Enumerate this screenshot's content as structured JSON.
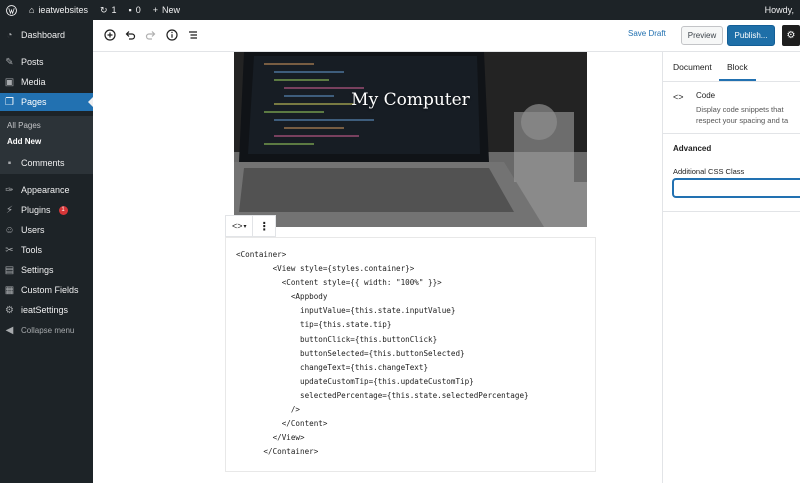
{
  "admin_bar": {
    "site_name": "ieatwebsites",
    "updates_count": "1",
    "comments_count": "0",
    "new_label": "New",
    "greeting": "Howdy,"
  },
  "sidebar": {
    "items": [
      {
        "label": "Dashboard",
        "icon": "dashboard-icon"
      },
      {
        "label": "Posts",
        "icon": "pushpin-icon"
      },
      {
        "label": "Media",
        "icon": "media-icon"
      },
      {
        "label": "Pages",
        "icon": "pages-icon"
      },
      {
        "label": "Comments",
        "icon": "comments-icon"
      },
      {
        "label": "Appearance",
        "icon": "paintbrush-icon"
      },
      {
        "label": "Plugins",
        "icon": "plugin-icon"
      },
      {
        "label": "Users",
        "icon": "users-icon"
      },
      {
        "label": "Tools",
        "icon": "wrench-icon"
      },
      {
        "label": "Settings",
        "icon": "settings-icon"
      },
      {
        "label": "Custom Fields",
        "icon": "grid-icon"
      },
      {
        "label": "ieatSettings",
        "icon": "gear-icon"
      }
    ],
    "pages_sub": [
      "All Pages",
      "Add New"
    ],
    "plugins_badge": "1",
    "collapse_label": "Collapse menu"
  },
  "header": {
    "save_draft": "Save Draft",
    "preview": "Preview",
    "publish": "Publish..."
  },
  "cover": {
    "title": "My Computer"
  },
  "code_block": {
    "lines": [
      "<Container>",
      "        <View style={styles.container}>",
      "          <Content style={{ width: \"100%\" }}>",
      "            <Appbody",
      "              inputValue={this.state.inputValue}",
      "              tip={this.state.tip}",
      "              buttonClick={this.buttonClick}",
      "              buttonSelected={this.buttonSelected}",
      "              changeText={this.changeText}",
      "              updateCustomTip={this.updateCustomTip}",
      "              selectedPercentage={this.state.selectedPercentage}",
      "            />",
      "          </Content>",
      "        </View>",
      "      </Container>"
    ]
  },
  "settings_panel": {
    "tabs": [
      "Document",
      "Block"
    ],
    "block_title": "Code",
    "block_desc_1": "Display code snippets that",
    "block_desc_2": "respect your spacing and ta",
    "advanced": "Advanced",
    "css_label": "Additional CSS Class",
    "css_value": ""
  },
  "colors": {
    "admin_dark": "#1d2327",
    "accent": "#2271b1"
  }
}
